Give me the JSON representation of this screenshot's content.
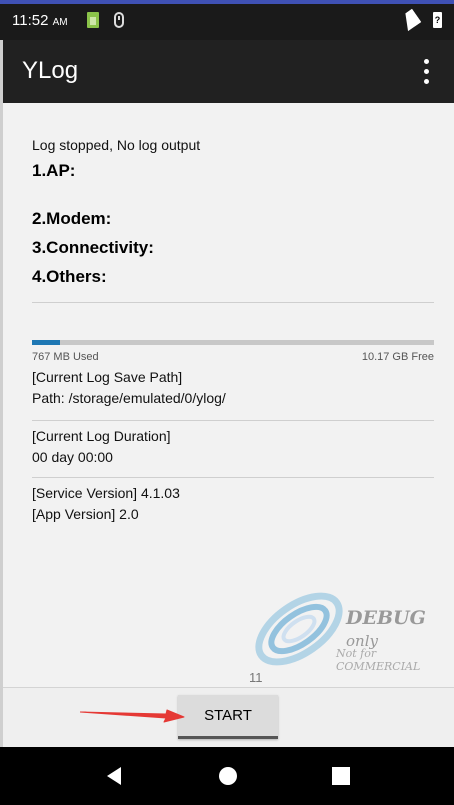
{
  "status_bar": {
    "time": "11:52",
    "ampm": "AM",
    "battery_symbol": "?",
    "icons": [
      "sim-card-icon",
      "mouse-icon",
      "signal-icon",
      "battery-icon"
    ]
  },
  "app_bar": {
    "title": "YLog",
    "menu_icon": "more-vert-icon"
  },
  "log": {
    "status": "Log stopped, No log output",
    "sections": [
      "1.AP:",
      "2.Modem:",
      "3.Connectivity:",
      "4.Others:"
    ]
  },
  "storage": {
    "used_label": "767 MB Used",
    "free_label": "10.17 GB Free",
    "used_fraction": 0.07,
    "bar_color": "#1f78b4"
  },
  "save_path": {
    "title": "[Current Log Save Path]",
    "value": "Path: /storage/emulated/0/ylog/"
  },
  "duration": {
    "title": "[Current Log Duration]",
    "value": "00 day 00:00"
  },
  "versions": {
    "service": "[Service Version]  4.1.03",
    "app": "[App Version]  2.0"
  },
  "watermark": {
    "line1": "DEBUG",
    "line1_suffix": "only",
    "line2": "Not for COMMERCIAL"
  },
  "page_count": "11",
  "actions": {
    "start_label": "START"
  },
  "annotation": {
    "arrow_color": "#e53935"
  },
  "nav": {
    "icons": [
      "back-icon",
      "home-icon",
      "recents-icon"
    ]
  }
}
